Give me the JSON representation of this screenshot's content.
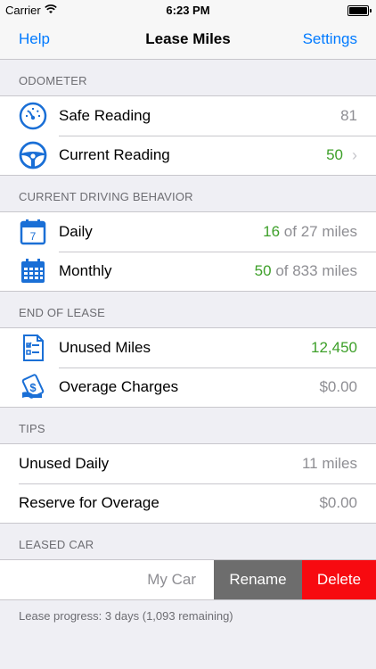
{
  "status": {
    "carrier": "Carrier",
    "time": "6:23 PM"
  },
  "nav": {
    "left": "Help",
    "title": "Lease Miles",
    "right": "Settings"
  },
  "odometer": {
    "header": "ODOMETER",
    "safe": {
      "label": "Safe Reading",
      "value": "81",
      "icon": "gauge-icon"
    },
    "current": {
      "label": "Current Reading",
      "value": "50",
      "icon": "steering-wheel-icon"
    }
  },
  "behavior": {
    "header": "CURRENT DRIVING BEHAVIOR",
    "daily": {
      "label": "Daily",
      "value": "16",
      "suffix": "of 27 miles",
      "icon": "calendar-day-icon",
      "icon_text": "7"
    },
    "monthly": {
      "label": "Monthly",
      "value": "50",
      "suffix": "of 833 miles",
      "icon": "calendar-month-icon"
    }
  },
  "end": {
    "header": "END OF LEASE",
    "unused": {
      "label": "Unused Miles",
      "value": "12,450",
      "icon": "checklist-icon"
    },
    "overage": {
      "label": "Overage Charges",
      "value": "$0.00",
      "icon": "money-icon"
    }
  },
  "tips": {
    "header": "TIPS",
    "unused_daily": {
      "label": "Unused Daily",
      "value": "11 miles"
    },
    "reserve": {
      "label": "Reserve for Overage",
      "value": "$0.00"
    }
  },
  "leased": {
    "header": "LEASED CAR",
    "car_name": "My Car",
    "rename": "Rename",
    "delete": "Delete",
    "progress": "Lease progress: 3 days (1,093 remaining)"
  },
  "colors": {
    "accent": "#007aff",
    "green": "#3ea02a",
    "delete": "#f70a10",
    "rename": "#6d6d6d"
  }
}
